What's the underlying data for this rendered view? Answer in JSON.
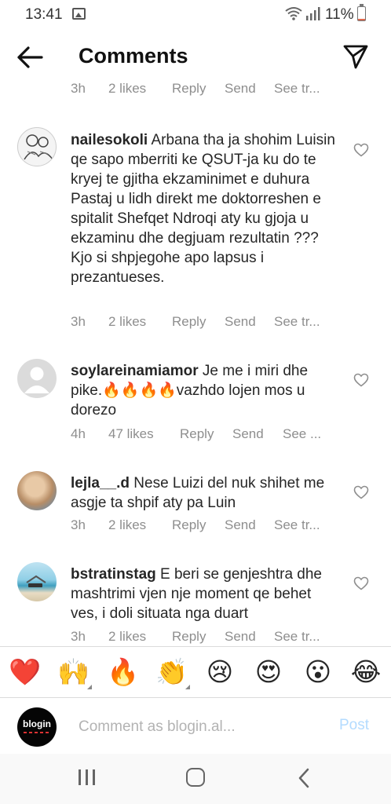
{
  "status_bar": {
    "time": "13:41",
    "battery": "11%",
    "battery_level": 0.11
  },
  "header": {
    "title": "Comments"
  },
  "top_meta": {
    "time": "3h",
    "likes": "2 likes",
    "reply": "Reply",
    "send": "Send",
    "see": "See tr..."
  },
  "comments": [
    {
      "username": "nailesokoli",
      "text": "Arbana tha ja shohim Luisin qe sapo mberriti ke QSUT-ja ku do te kryej te gjitha ekzaminimet e duhura Pastaj u lidh direkt me doktorreshen e spitalit Shefqet Ndroqi aty ku gjoja u ekzaminu dhe degjuam rezultatin ???",
      "text2": "Kjo si shpjegohe apo lapsus i prezantueses.",
      "time": "3h",
      "likes": "2 likes",
      "reply": "Reply",
      "send": "Send",
      "see": "See tr..."
    },
    {
      "username": "soylareinamiamor",
      "text": "Je me i miri dhe pike.🔥🔥🔥🔥vazhdo lojen mos u dorezo",
      "time": "4h",
      "likes": "47 likes",
      "reply": "Reply",
      "send": "Send",
      "see": "See ..."
    },
    {
      "username": "lejla__.d",
      "text": "Nese Luizi del nuk shihet me asgje ta shpif aty pa Luin",
      "time": "3h",
      "likes": "2 likes",
      "reply": "Reply",
      "send": "Send",
      "see": "See tr..."
    },
    {
      "username": "bstratinstag",
      "text": "E beri se genjeshtra dhe mashtrimi vjen nje moment qe behet ves, i doli situata nga duart",
      "time": "3h",
      "likes": "2 likes",
      "reply": "Reply",
      "send": "Send",
      "see": "See tr..."
    }
  ],
  "reactions": [
    "❤️",
    "🙌",
    "🔥",
    "👏",
    "😢",
    "😍",
    "😮",
    "😂"
  ],
  "input": {
    "placeholder": "Comment as blogin.al...",
    "post_label": "Post",
    "avatar_text": "blogin"
  },
  "colors": {
    "post": "#b3dbff",
    "meta": "#8e8e8e",
    "text": "#262626"
  }
}
